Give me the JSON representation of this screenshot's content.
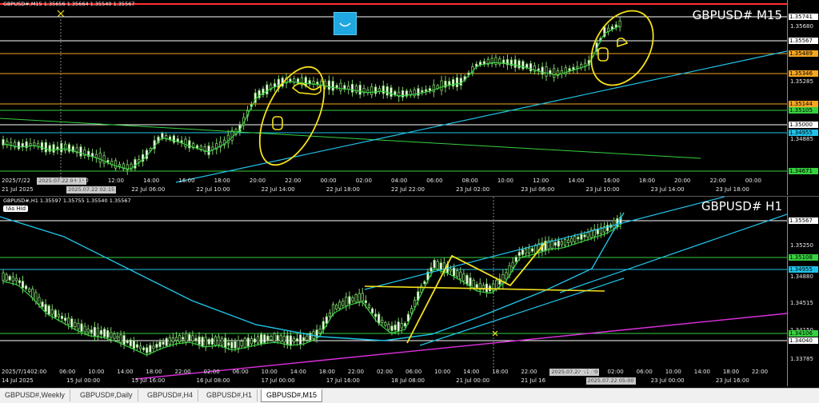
{
  "m15": {
    "header": "GBPUSD#,M15  1.35656 1.35664 1.35540 1.35567",
    "symbol_label": "GBPUSD# M15",
    "price_ticks": [
      "1.35680",
      "1.35285",
      "1.34885"
    ],
    "price_levels": [
      {
        "value": "1.35741",
        "color": "#ffffff"
      },
      {
        "value": "1.35567",
        "color": "#ffffff"
      },
      {
        "value": "1.35489",
        "color": "#f5a623"
      },
      {
        "value": "1.35346",
        "color": "#f5a623"
      },
      {
        "value": "1.35144",
        "color": "#f5a623"
      },
      {
        "value": "1.35105",
        "color": "#37d13f"
      },
      {
        "value": "1.35000",
        "color": "#ffffff"
      },
      {
        "value": "1.34955",
        "color": "#20c3e8"
      },
      {
        "value": "1.34671",
        "color": "#37d13f"
      }
    ],
    "time_top": [
      "2025/7/22",
      "2025.07.22 08:15",
      "10:00",
      "12:00",
      "14:00",
      "16:00",
      "18:00",
      "20:00",
      "22:00",
      "00:00",
      "02:00",
      "04:00",
      "06:00",
      "08:00",
      "10:00",
      "12:00",
      "14:00",
      "16:00",
      "18:00",
      "20:00",
      "22:00",
      "00:00"
    ],
    "time_bottom": [
      "21 Jul 2025",
      "2025.07.22 02:15",
      "22 Jul 06:00",
      "22 Jul 10:00",
      "22 Jul 14:00",
      "22 Jul 18:00",
      "22 Jul 22:00",
      "23 Jul 02:00",
      "23 Jul 06:00",
      "23 Jul 10:00",
      "23 Jul 14:00",
      "23 Jul 18:00"
    ]
  },
  "h1": {
    "header": "GBPUSD#,H1  1.35597 1.35755 1.35540 1.35567",
    "symbol_label": "GBPUSD# H1",
    "as_hid": "!As Hid",
    "price_ticks": [
      "1.35250",
      "1.34880",
      "1.34515",
      "1.34150",
      "1.33785"
    ],
    "price_levels": [
      {
        "value": "1.35567",
        "color": "#ffffff"
      },
      {
        "value": "1.35108",
        "color": "#37d13f"
      },
      {
        "value": "1.34955",
        "color": "#20c3e8"
      },
      {
        "value": "1.34106",
        "color": "#37d13f"
      },
      {
        "value": "1.34040",
        "color": "#ffffff"
      }
    ],
    "time_top": [
      "2025/7/14",
      "02:00",
      "06:00",
      "10:00",
      "14:00",
      "18:00",
      "22:00",
      "02:00",
      "06:00",
      "10:00",
      "14:00",
      "18:00",
      "22:00",
      "02:00",
      "06:00",
      "10:00",
      "14:00",
      "18:00",
      "22:00",
      "2025.07.22 11:00",
      "22:00",
      "02:00",
      "06:00",
      "10:00",
      "14:00",
      "18:00",
      "22:00"
    ],
    "time_bottom": [
      "14 Jul 2025",
      "15 Jul 00:00",
      "15 Jul 16:00",
      "16 Jul 08:00",
      "17 Jul 00:00",
      "17 Jul 16:00",
      "18 Jul 08:00",
      "21 Jul 00:00",
      "21 Jul 16",
      "2025.07.22 05:00",
      "23 Jul 00:00",
      "23 Jul 16:00"
    ]
  },
  "tabs": [
    "GBPUSD#,Weekly",
    "GBPUSD#,Daily",
    "GBPUSD#,H4",
    "GBPUSD#,H1",
    "GBPUSD#,M15"
  ],
  "active_tab": "GBPUSD#,M15",
  "icons": {
    "indicator_button": "smile-indicator-icon",
    "crosshair": "crosshair-marker-icon"
  }
}
